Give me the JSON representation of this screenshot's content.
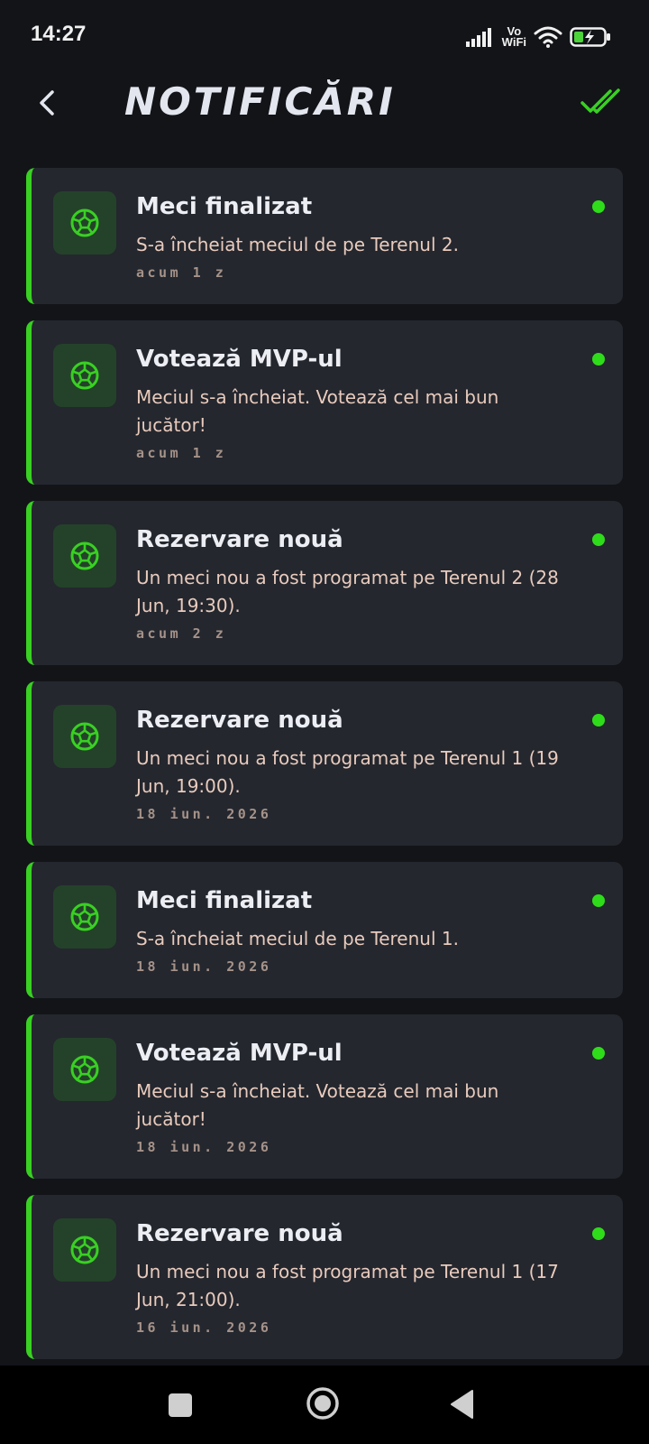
{
  "status_bar": {
    "time": "14:27",
    "vowifi_top": "Vo",
    "vowifi_bottom": "WiFi",
    "icons": [
      "signal-icon",
      "vowifi-icon",
      "wifi-icon",
      "battery-charging-icon"
    ]
  },
  "header": {
    "title": "NOTIFICĂRI",
    "back_icon": "chevron-left-icon",
    "mark_all_icon": "double-check-icon"
  },
  "colors": {
    "accent": "#39d023",
    "dot": "#2fdc1a",
    "background": "#121418",
    "card": "#24272e",
    "icon_bg": "#24422a",
    "body_text": "#e9cbbd",
    "time_text": "#a59289"
  },
  "notifications": [
    {
      "title": "Meci finalizat",
      "text": "S-a încheiat meciul de pe Terenul 2.",
      "time": "acum 1 z",
      "icon": "soccer-ball-icon",
      "unread": true
    },
    {
      "title": "Votează MVP-ul",
      "text": "Meciul s-a încheiat. Votează cel mai bun jucător!",
      "time": "acum 1 z",
      "icon": "soccer-ball-icon",
      "unread": true
    },
    {
      "title": "Rezervare nouă",
      "text": "Un meci nou a fost programat pe Terenul 2 (28 Jun, 19:30).",
      "time": "acum 2 z",
      "icon": "soccer-ball-icon",
      "unread": true
    },
    {
      "title": "Rezervare nouă",
      "text": "Un meci nou a fost programat pe Terenul 1 (19 Jun, 19:00).",
      "time": "18 iun. 2026",
      "icon": "soccer-ball-icon",
      "unread": true
    },
    {
      "title": "Meci finalizat",
      "text": "S-a încheiat meciul de pe Terenul 1.",
      "time": "18 iun. 2026",
      "icon": "soccer-ball-icon",
      "unread": true
    },
    {
      "title": "Votează MVP-ul",
      "text": "Meciul s-a încheiat. Votează cel mai bun jucător!",
      "time": "18 iun. 2026",
      "icon": "soccer-ball-icon",
      "unread": true
    },
    {
      "title": "Rezervare nouă",
      "text": "Un meci nou a fost programat pe Terenul 1 (17 Jun, 21:00).",
      "time": "16 iun. 2026",
      "icon": "soccer-ball-icon",
      "unread": true
    }
  ],
  "nav_bar": {
    "buttons": [
      "recents-square-icon",
      "home-circle-icon",
      "back-triangle-icon"
    ]
  }
}
